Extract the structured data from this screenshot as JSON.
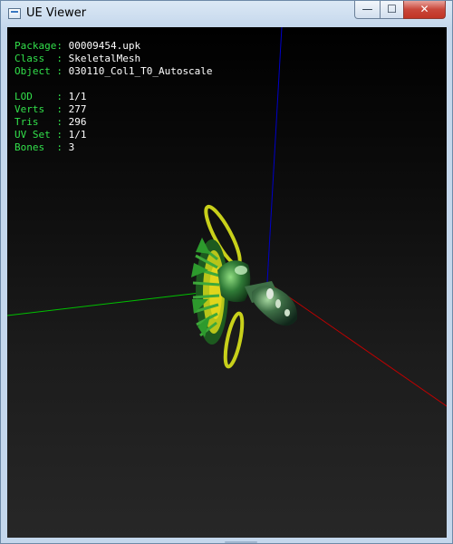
{
  "window": {
    "title": "UE Viewer",
    "minimize_glyph": "—",
    "maximize_glyph": "☐",
    "close_glyph": "✕"
  },
  "info": {
    "package_label": "Package: ",
    "package_value": "00009454.upk",
    "class_label": "Class  : ",
    "class_value": "SkeletalMesh",
    "object_label": "Object : ",
    "object_value": "030110_Col1_T0_Autoscale",
    "lod_label": "LOD    : ",
    "lod_value": "1/1",
    "verts_label": "Verts  : ",
    "verts_value": "277",
    "tris_label": "Tris   : ",
    "tris_value": "296",
    "uvset_label": "UV Set : ",
    "uvset_value": "1/1",
    "bones_label": "Bones  : ",
    "bones_value": "3"
  },
  "colors": {
    "label": "#32e04b",
    "value": "#ffffff",
    "axis_x": "#c00000",
    "axis_y": "#00c000",
    "axis_z": "#0000c8"
  }
}
